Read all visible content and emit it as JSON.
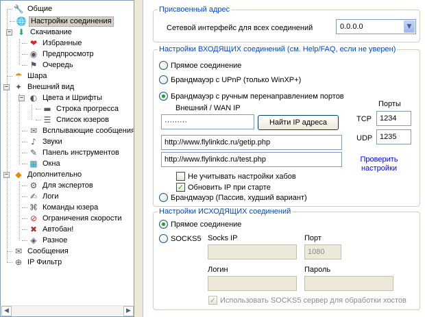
{
  "tree": {
    "items": [
      {
        "label": "Общие",
        "icon": "wrench-icon"
      },
      {
        "label": "Настройки соединения",
        "icon": "globe-network-icon",
        "selected": true
      },
      {
        "label": "Скачивание",
        "icon": "download-icon"
      },
      {
        "label": "Избранные",
        "icon": "heart-icon"
      },
      {
        "label": "Предпросмотр",
        "icon": "preview-icon"
      },
      {
        "label": "Очередь",
        "icon": "queue-icon"
      },
      {
        "label": "Шара",
        "icon": "share-icon"
      },
      {
        "label": "Внешний вид",
        "icon": "appearance-icon"
      },
      {
        "label": "Цвета и Шрифты",
        "icon": "palette-icon"
      },
      {
        "label": "Строка прогресса",
        "icon": "progress-bar-icon"
      },
      {
        "label": "Список юзеров",
        "icon": "user-list-icon"
      },
      {
        "label": "Всплывающие сообщения",
        "icon": "popup-message-icon"
      },
      {
        "label": "Звуки",
        "icon": "sound-icon"
      },
      {
        "label": "Панель инструментов",
        "icon": "toolbar-icon"
      },
      {
        "label": "Окна",
        "icon": "windows-icon"
      },
      {
        "label": "Дополнительно",
        "icon": "advanced-icon"
      },
      {
        "label": "Для экспертов",
        "icon": "expert-icon"
      },
      {
        "label": "Логи",
        "icon": "log-icon"
      },
      {
        "label": "Команды юзера",
        "icon": "user-commands-icon"
      },
      {
        "label": "Ограничения скорости",
        "icon": "speed-limit-icon"
      },
      {
        "label": "Автобан!",
        "icon": "autoban-icon"
      },
      {
        "label": "Разное",
        "icon": "misc-icon"
      },
      {
        "label": "Сообщения",
        "icon": "messages-icon"
      },
      {
        "label": "IP Фильтр",
        "icon": "ip-filter-icon"
      }
    ]
  },
  "assigned": {
    "title": "Присвоенный адрес",
    "interface_label": "Сетевой интерфейс для всех соединений",
    "interface_value": "0.0.0.0"
  },
  "incoming": {
    "title": "Настройки ВХОДЯЩИХ соединений (см. Help/FAQ, если не уверен)",
    "opt_direct": "Прямое соединение",
    "opt_upnp": "Брандмауэр с UPnP (только WinXP+)",
    "opt_manual": "Брандмауэр с ручным перенаправлением портов",
    "wan_label": "Внешний / WAN IP",
    "wan_value": "·········",
    "find_ip_button": "Найти IP адреса",
    "ports_label": "Порты",
    "tcp_label": "TCP",
    "tcp_value": "1234",
    "udp_label": "UDP",
    "udp_value": "1235",
    "url1": "http://www.flylinkdc.ru/getip.php",
    "url2": "http://www.flylinkdc.ru/test.php",
    "check_settings_link": "Проверить настройки",
    "ignore_hubs_label": "Не учитывать настройки хабов",
    "update_ip_label": "Обновить IP при старте",
    "opt_passive": "Брандмауэр (Пассив, худший вариант)"
  },
  "outgoing": {
    "title": "Настройки ИСХОДЯЩИХ соединений",
    "opt_direct": "Прямое соединение",
    "opt_socks": "SOCKS5",
    "socks_ip_label": "Socks IP",
    "port_label": "Порт",
    "port_value": "1080",
    "login_label": "Логин",
    "password_label": "Пароль",
    "use_socks_hosts_label": "Использовать SOCKS5 сервер для обработки хостов"
  },
  "scrollbar": {
    "left_arrow": "◀",
    "right_arrow": "▶"
  }
}
